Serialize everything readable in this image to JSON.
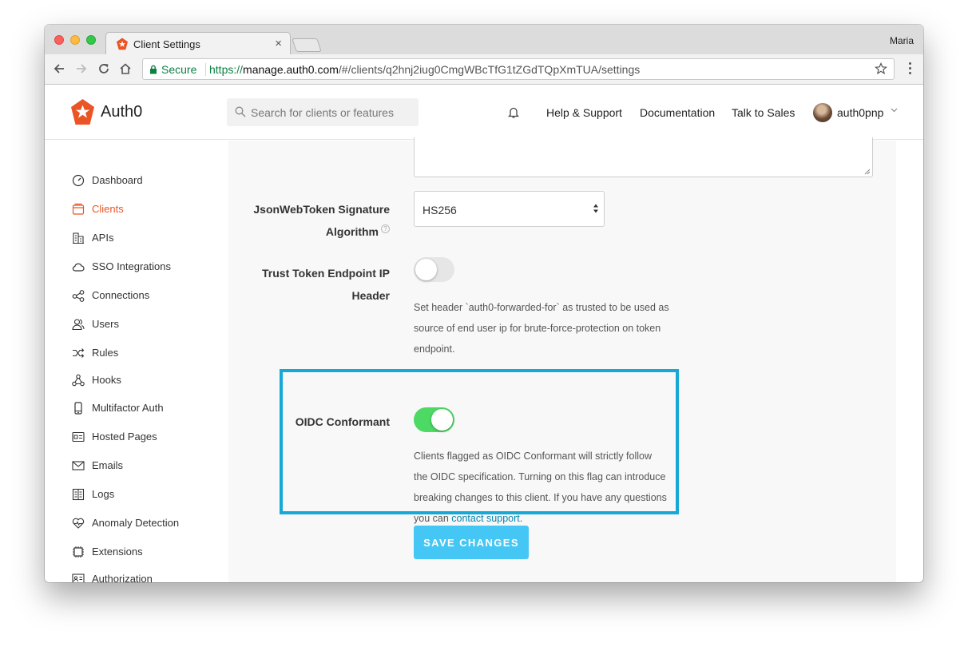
{
  "browser": {
    "tab_title": "Client Settings",
    "profile_name": "Maria",
    "secure_label": "Secure",
    "url_scheme": "https://",
    "url_host": "manage.auth0.com",
    "url_path": "/#/clients/q2hnj2iug0CmgWBcTfG1tZGdTQpXmTUA/settings"
  },
  "header": {
    "brand": "Auth0",
    "search_placeholder": "Search for clients or features",
    "nav": [
      "Help & Support",
      "Documentation",
      "Talk to Sales"
    ],
    "user_name": "auth0pnp"
  },
  "sidebar": {
    "items": [
      {
        "label": "Dashboard",
        "icon": "dashboard-icon"
      },
      {
        "label": "Clients",
        "icon": "clients-icon",
        "active": true
      },
      {
        "label": "APIs",
        "icon": "apis-icon"
      },
      {
        "label": "SSO Integrations",
        "icon": "cloud-icon"
      },
      {
        "label": "Connections",
        "icon": "connections-icon"
      },
      {
        "label": "Users",
        "icon": "users-icon"
      },
      {
        "label": "Rules",
        "icon": "rules-icon"
      },
      {
        "label": "Hooks",
        "icon": "hooks-icon"
      },
      {
        "label": "Multifactor Auth",
        "icon": "mobile-icon"
      },
      {
        "label": "Hosted Pages",
        "icon": "hosted-pages-icon"
      },
      {
        "label": "Emails",
        "icon": "email-icon"
      },
      {
        "label": "Logs",
        "icon": "logs-icon"
      },
      {
        "label": "Anomaly Detection",
        "icon": "heart-icon"
      },
      {
        "label": "Extensions",
        "icon": "extensions-icon"
      },
      {
        "label": "Authorization",
        "icon": "authorization-icon"
      }
    ]
  },
  "settings": {
    "jwt_label_line1": "JsonWebToken Signature",
    "jwt_label_line2": "Algorithm",
    "jwt_value": "HS256",
    "trust_label_line1": "Trust Token Endpoint IP",
    "trust_label_line2": "Header",
    "trust_enabled": false,
    "trust_desc": "Set header `auth0-forwarded-for` as trusted to be used as source of end user ip for brute-force-protection on token endpoint.",
    "oidc_label": "OIDC Conformant",
    "oidc_enabled": true,
    "oidc_desc": "Clients flagged as OIDC Conformant will strictly follow the OIDC specification. Turning on this flag can introduce breaking changes to this client. If you have any questions you can",
    "oidc_link": "contact support",
    "oidc_desc_end": ".",
    "save_label": "SAVE CHANGES"
  },
  "colors": {
    "brand_orange": "#eb5424",
    "toggle_on": "#4cd964",
    "highlight": "#16a8d6",
    "save_button": "#44c7f4",
    "link": "#0a84ae"
  }
}
